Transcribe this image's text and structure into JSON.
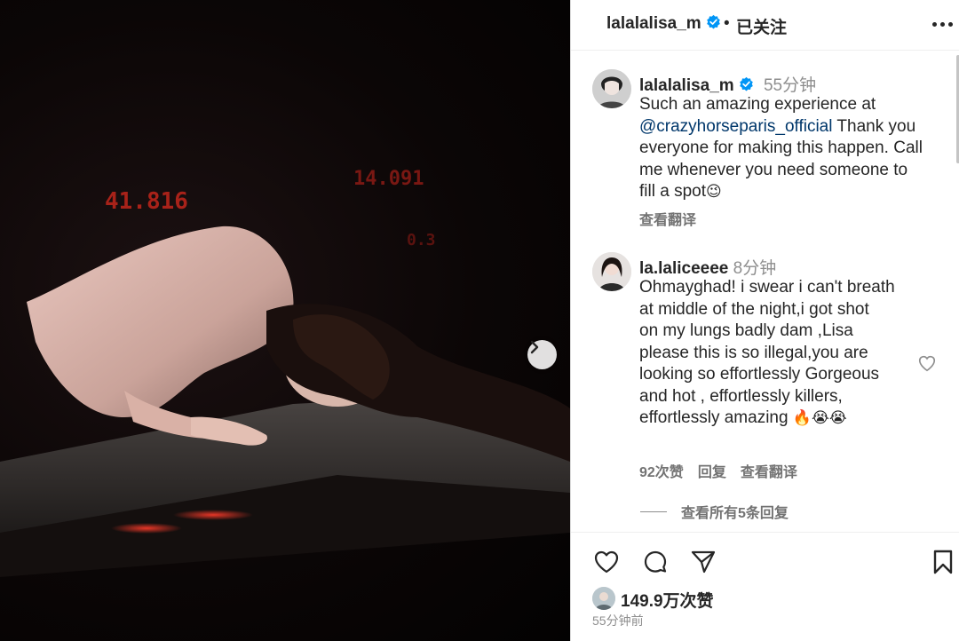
{
  "header": {
    "username": "lalalalisa_m",
    "separator": "•",
    "follow_status": "已关注"
  },
  "caption": {
    "username": "lalalalisa_m",
    "time": "55分钟",
    "text_before": "Such an amazing experience at ",
    "mention": "@crazyhorseparis_official",
    "text_after": " Thank you everyone for making this happen. Call me whenever you need someone to fill a spot",
    "emoji": "😉",
    "translate_label": "查看翻译"
  },
  "comment": {
    "username": "la.laliceeee",
    "time": "8分钟",
    "line1": "Ohmayghad! i swear i can't breath at middle of the night,i got shot",
    "line2": "on my lungs badly dam ,Lisa please this is so illegal,you are looking so effortlessly Gorgeous and hot , effortlessly killers, effortlessly amazing ",
    "emojis": "🔥😭😭",
    "likes_label": "92次赞",
    "reply_label": "回复",
    "translate_label": "查看翻译",
    "view_replies_label": "查看所有5条回复"
  },
  "footer": {
    "likes_count": "149.9万次赞",
    "post_time": "55分钟前"
  },
  "media": {
    "screen_numbers": [
      "41.816",
      "14.091",
      "0.3"
    ]
  },
  "colors": {
    "mention": "#00376b",
    "verified": "#0095f6",
    "muted_text": "#737373"
  },
  "icons": [
    "verified-badge-icon",
    "more-options-icon",
    "next-arrow-icon",
    "heart-icon",
    "comment-icon",
    "share-icon",
    "bookmark-icon"
  ]
}
